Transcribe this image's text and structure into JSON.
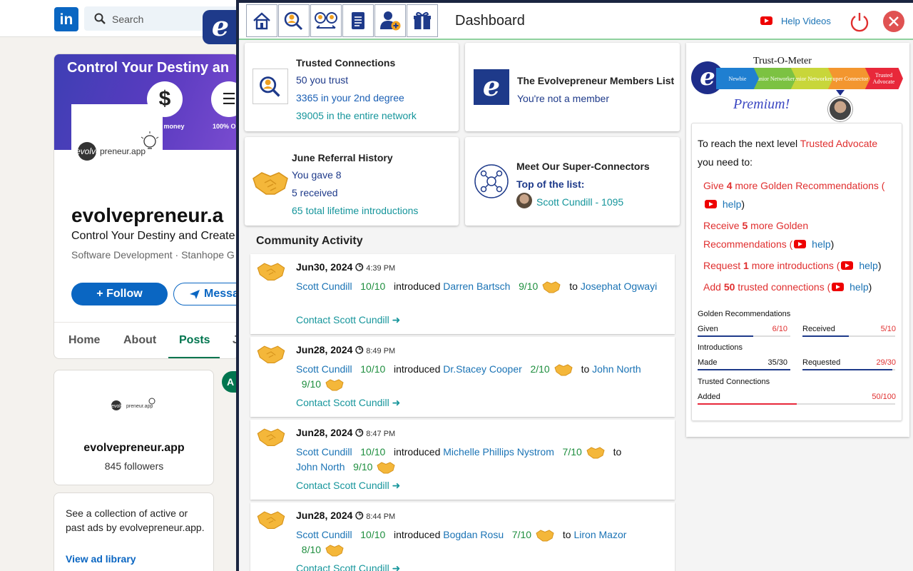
{
  "linkedin": {
    "logo": "in",
    "search_placeholder": "Search",
    "banner_title": "Control Your Destiny an",
    "banner_icon_1": "$",
    "banner_caption_1": "e & money",
    "banner_caption_2": "100% O",
    "company_name": "evolvepreneur.a",
    "tagline": "Control Your Destiny and Create",
    "meta": "Software Development · Stanhope G",
    "follow_label": "Follow",
    "message_label": "Messa",
    "tabs": [
      "Home",
      "About",
      "Posts",
      "J"
    ],
    "logo_text": "evolvepreneur.app",
    "followers_name": "evolvepreneur.app",
    "followers_count": "845 followers",
    "ad_text": "See a collection of active or past ads by evolvepreneur.app.",
    "ad_link": "View ad library",
    "side_letter": "e",
    "side_tab": "A"
  },
  "toolbar": {
    "title": "Dashboard",
    "help_videos": "Help Videos",
    "icons": [
      "home-icon",
      "trusted-search-icon",
      "connectors-icon",
      "document-icon",
      "add-person-icon",
      "gift-icon"
    ]
  },
  "trusted": {
    "title": "Trusted Connections",
    "line1": "50 you trust",
    "line2": "3365 in your 2nd degree",
    "line3": "39005 in the entire network"
  },
  "members": {
    "title": "The Evolvepreneur Members List",
    "status": "You're not a member"
  },
  "referral": {
    "title": "June Referral History",
    "gave": "You gave 8",
    "received": "5 received",
    "lifetime": "65 total lifetime introductions"
  },
  "super": {
    "title": "Meet Our Super-Connectors",
    "subtitle": "Top of the list:",
    "top": "Scott Cundill - 1095"
  },
  "community": {
    "title": "Community Activity",
    "items": [
      {
        "date": "Jun30, 2024",
        "time": "4:39 PM",
        "from": "Scott Cundill",
        "from_score": "10/10",
        "verb": "introduced",
        "who": "Darren Bartsch",
        "who_score": "9/10",
        "to_word": "to",
        "to": "Josephat Ogwayi",
        "to_score": "",
        "contact": "Contact Scott Cundill"
      },
      {
        "date": "Jun28, 2024",
        "time": "8:49 PM",
        "from": "Scott Cundill",
        "from_score": "10/10",
        "verb": "introduced",
        "who": "Dr.Stacey Cooper",
        "who_score": "2/10",
        "to_word": "to",
        "to": "John North",
        "to_score": "9/10",
        "contact": "Contact Scott Cundill"
      },
      {
        "date": "Jun28, 2024",
        "time": "8:47 PM",
        "from": "Scott Cundill",
        "from_score": "10/10",
        "verb": "introduced",
        "who": "Michelle Phillips Nystrom",
        "who_score": "7/10",
        "to_word": "to",
        "to": "John North",
        "to_score": "9/10",
        "contact": "Contact Scott Cundill"
      },
      {
        "date": "Jun28, 2024",
        "time": "8:44 PM",
        "from": "Scott Cundill",
        "from_score": "10/10",
        "verb": "introduced",
        "who": "Bogdan Rosu",
        "who_score": "7/10",
        "to_word": "to",
        "to": "Liron Mazor",
        "to_score": "8/10",
        "contact": "Contact Scott Cundill"
      }
    ]
  },
  "meter": {
    "title": "Trust-O-Meter",
    "logo_letter": "e",
    "levels": [
      "Newbie",
      "Junior Networker",
      "Senior Networker",
      "Super Connector",
      "Trusted Advocate"
    ],
    "level_colors": [
      "#1f7fd1",
      "#7cc242",
      "#c8d63a",
      "#f3962f",
      "#e8283a"
    ],
    "badge": "Premium!"
  },
  "next_level": {
    "intro": "To reach the next level",
    "level_name": "Trusted Advocate",
    "need": "you need to:",
    "req1_a": "Give",
    "req1_n": "4",
    "req1_b": "more Golden Recommendations (",
    "req2_a": "Receive",
    "req2_n": "5",
    "req2_b": "more Golden",
    "req2_c": "Recommendations (",
    "req3_a": "Request",
    "req3_n": "1",
    "req3_b": "more introductions (",
    "req4_a": "Add",
    "req4_n": "50",
    "req4_b": "trusted connections (",
    "help": "help",
    "close_paren": ")"
  },
  "metrics": {
    "golden_title": "Golden Recommendations",
    "given_label": "Given",
    "given_value": "6/10",
    "given_fraction": 0.6,
    "received_label": "Received",
    "received_value": "5/10",
    "received_fraction": 0.5,
    "intro_title": "Introductions",
    "made_label": "Made",
    "made_value": "35/30",
    "made_fraction": 1.0,
    "requested_label": "Requested",
    "requested_value": "29/30",
    "requested_fraction": 0.97,
    "trusted_title": "Trusted Connections",
    "added_label": "Added",
    "added_value": "50/100",
    "added_fraction": 0.5
  }
}
